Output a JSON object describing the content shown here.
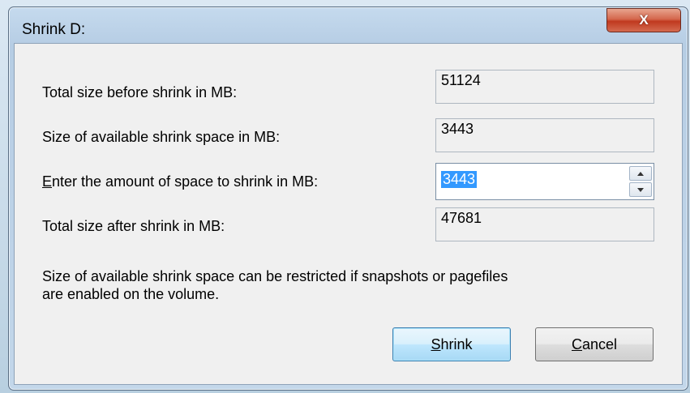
{
  "window": {
    "title": "Shrink D:",
    "close_label": "X"
  },
  "fields": {
    "total_before": {
      "label": "Total size before shrink in MB:",
      "value": "51124"
    },
    "available": {
      "label": "Size of available shrink space in MB:",
      "value": "3443"
    },
    "amount": {
      "label_accel": "E",
      "label_rest": "nter the amount of space to shrink in MB:",
      "value": "3443"
    },
    "total_after": {
      "label": "Total size after shrink in MB:",
      "value": "47681"
    }
  },
  "note": {
    "line1": "Size of available shrink space can be restricted if snapshots or pagefiles",
    "line2": "are enabled on the volume."
  },
  "buttons": {
    "shrink": {
      "accel": "S",
      "rest": "hrink"
    },
    "cancel": {
      "accel": "C",
      "rest": "ancel"
    }
  },
  "icons": {
    "spin_up": "chevron-up-icon",
    "spin_down": "chevron-down-icon"
  }
}
